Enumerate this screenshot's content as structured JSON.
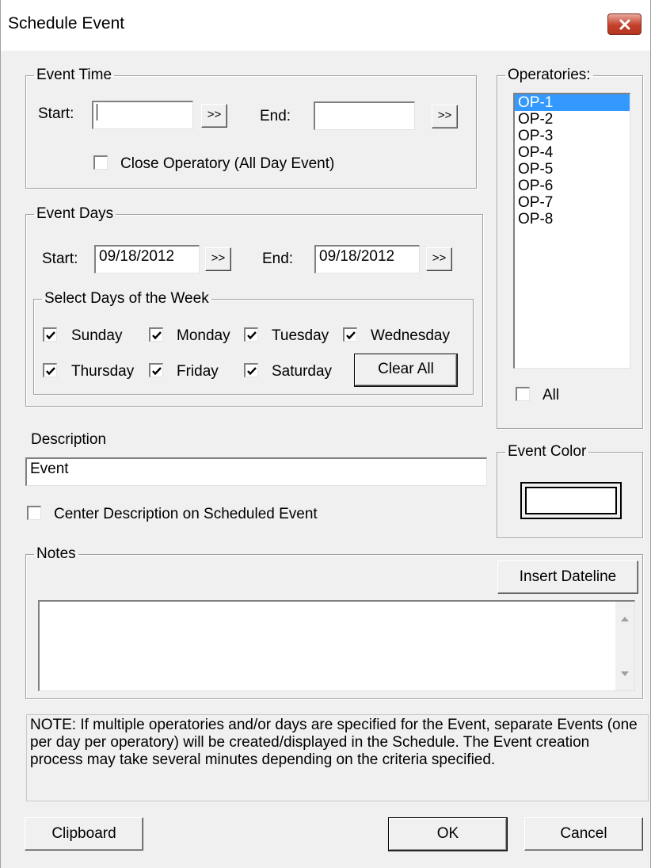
{
  "window": {
    "title": "Schedule Event"
  },
  "event_time": {
    "legend": "Event Time",
    "start_label": "Start:",
    "start_value": "",
    "end_label": "End:",
    "end_value": "",
    "picker_label": ">>",
    "close_operatory_label": "Close Operatory (All Day Event)",
    "close_operatory_checked": false
  },
  "event_days": {
    "legend": "Event Days",
    "start_label": "Start:",
    "start_value": "09/18/2012",
    "end_label": "End:",
    "end_value": "09/18/2012",
    "picker_label": ">>",
    "week": {
      "legend": "Select Days of the Week",
      "days": [
        {
          "label": "Sunday",
          "checked": true
        },
        {
          "label": "Monday",
          "checked": true
        },
        {
          "label": "Tuesday",
          "checked": true
        },
        {
          "label": "Wednesday",
          "checked": true
        },
        {
          "label": "Thursday",
          "checked": true
        },
        {
          "label": "Friday",
          "checked": true
        },
        {
          "label": "Saturday",
          "checked": true
        }
      ],
      "clear_all_label": "Clear All"
    }
  },
  "operatories": {
    "legend": "Operatories:",
    "items": [
      "OP-1",
      "OP-2",
      "OP-3",
      "OP-4",
      "OP-5",
      "OP-6",
      "OP-7",
      "OP-8"
    ],
    "selected": "OP-1",
    "all_label": "All",
    "all_checked": false
  },
  "description": {
    "label": "Description",
    "value": "Event",
    "center_label": "Center Description on Scheduled Event",
    "center_checked": false
  },
  "event_color": {
    "legend": "Event Color",
    "color": "#ffffff"
  },
  "notes": {
    "legend": "Notes",
    "insert_dateline_label": "Insert Dateline",
    "value": ""
  },
  "note_text": "NOTE: If multiple operatories and/or days are specified for the Event, separate Events (one per day per operatory) will be created/displayed in the Schedule.  The Event creation process may take several minutes depending on the criteria specified.",
  "footer": {
    "clipboard_label": "Clipboard",
    "ok_label": "OK",
    "cancel_label": "Cancel"
  },
  "colors": {
    "selection": "#3399ff",
    "dialog_bg": "#f0f0f0",
    "close_button": "#c4402b"
  }
}
